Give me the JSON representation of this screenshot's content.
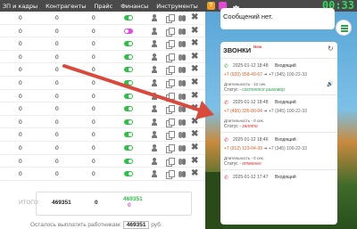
{
  "nav": {
    "items": [
      "ЗП и кадры",
      "Контрагенты",
      "Прайс",
      "Финансы",
      "Инструменты"
    ],
    "help_label": "?",
    "clock": "00:33"
  },
  "table": {
    "rows": [
      {
        "c1": "0",
        "c2": "0",
        "c3": "0",
        "toggle": "on"
      },
      {
        "c1": "0",
        "c2": "0",
        "c3": "0",
        "toggle": "off"
      },
      {
        "c1": "0",
        "c2": "0",
        "c3": "0",
        "toggle": "on"
      },
      {
        "c1": "0",
        "c2": "0",
        "c3": "0",
        "toggle": "on"
      },
      {
        "c1": "0",
        "c2": "0",
        "c3": "0",
        "toggle": "on"
      },
      {
        "c1": "0",
        "c2": "0",
        "c3": "0",
        "toggle": "on"
      },
      {
        "c1": "0",
        "c2": "0",
        "c3": "0",
        "toggle": "on"
      },
      {
        "c1": "0",
        "c2": "0",
        "c3": "0",
        "toggle": "on"
      },
      {
        "c1": "0",
        "c2": "0",
        "c3": "0",
        "toggle": "on"
      },
      {
        "c1": "0",
        "c2": "0",
        "c3": "0",
        "toggle": "on"
      },
      {
        "c1": "0",
        "c2": "0",
        "c3": "0",
        "toggle": "on"
      },
      {
        "c1": "0",
        "c2": "0",
        "c3": "0",
        "toggle": "on"
      },
      {
        "c1": "0",
        "c2": "0",
        "c3": "0",
        "toggle": "on"
      }
    ],
    "delete_glyph": "✖"
  },
  "totals": {
    "label": "ИТОГО:",
    "v1": "469351",
    "v2": "0",
    "v3": "469351",
    "v4": "0"
  },
  "footer": {
    "text": "Осталось выплатить работникам:",
    "amount": "469351",
    "unit": "руб."
  },
  "messages": {
    "text": "Сообщений нет."
  },
  "calls": {
    "title": "ЗВОНКИ",
    "badge": "New",
    "refresh_glyph": "↻",
    "items": [
      {
        "time": "2025-01-12 18:48",
        "direction": "Входящий",
        "from": "+7 (920) 958-49-67",
        "arrow": "➔",
        "to": "+7 (345) 100-22-33",
        "duration": "Длительность - 12 сек.",
        "status_label": "Статус -",
        "status_value": "состоялся разговор",
        "status_color": "green",
        "phone_color": "#2fa44e"
      },
      {
        "time": "2025-01-12 18:48",
        "direction": "Входящий",
        "from": "+7 (495) 335-80-04",
        "arrow": "➔",
        "to": "+7 (345) 100-22-33",
        "duration": "Длительность - 0 сек.",
        "status_label": "Статус -",
        "status_value": "занято",
        "status_color": "red",
        "phone_color": "#d33"
      },
      {
        "time": "2025-01-12 18:46",
        "direction": "Входящий",
        "from": "+7 (912) 123-04-39",
        "arrow": "➔",
        "to": "+7 (345) 100-22-33",
        "duration": "Длительность - 0 сек.",
        "status_label": "Статус -",
        "status_value": "отменен",
        "status_color": "red",
        "phone_color": "#d33"
      },
      {
        "time": "2025-01-12 17:47",
        "direction": "Входящий",
        "from": "",
        "arrow": "",
        "to": "",
        "duration": "",
        "status_label": "",
        "status_value": "",
        "status_color": "red",
        "phone_color": "#d33"
      }
    ]
  },
  "colors": {
    "topbar": "#4a4a4a",
    "clock": "#2fdc5a",
    "toggle_on": "#2fc04a",
    "toggle_off": "#e04fe0",
    "arrow": "#d9493c"
  }
}
